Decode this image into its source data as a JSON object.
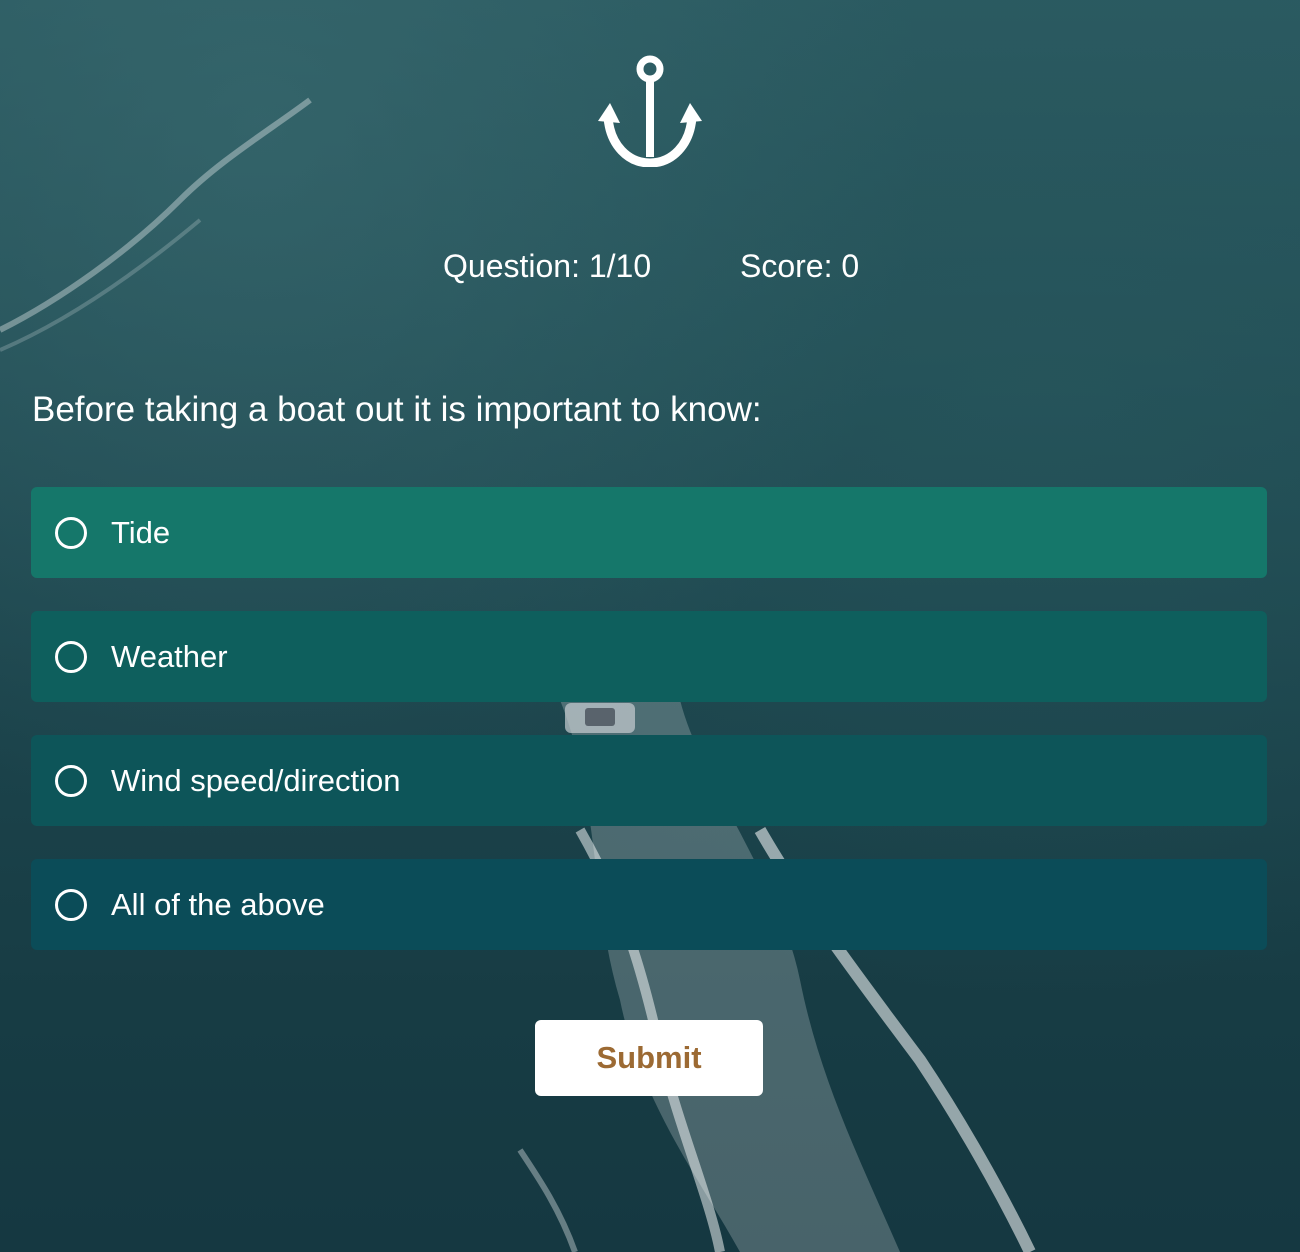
{
  "header": {
    "logo_icon": "anchor-icon"
  },
  "stats": {
    "question_label": "Question: 1/10",
    "score_label": "Score: 0"
  },
  "quiz": {
    "question": "Before taking a boat out it is important to know:",
    "options": [
      {
        "label": "Tide",
        "color": "#15776a"
      },
      {
        "label": "Weather",
        "color": "#0e5f5d"
      },
      {
        "label": "Wind speed/direction",
        "color": "#0d5559"
      },
      {
        "label": "All of the above",
        "color": "#0b4c58"
      }
    ],
    "submit_label": "Submit"
  },
  "theme": {
    "submit_text_color": "#9c6a33",
    "background": "#1c444c"
  }
}
